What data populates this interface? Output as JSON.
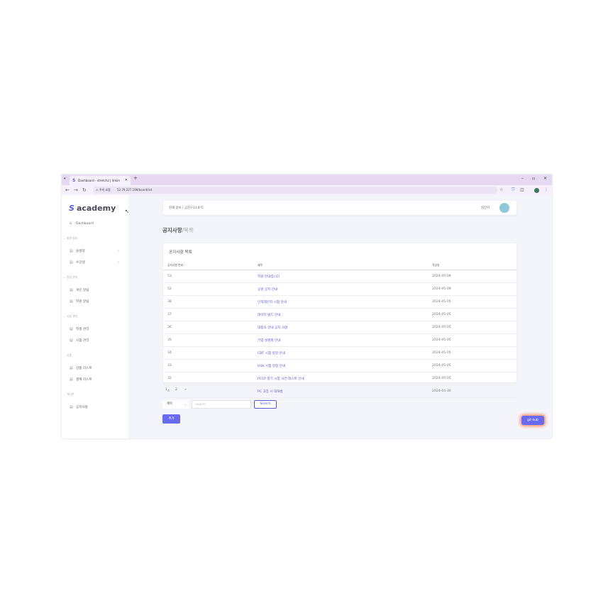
{
  "browser": {
    "tab_title": "Dashboard - stretchz | linkin",
    "url_warning": "주의 요함",
    "url": "52.79.227.198/board/list"
  },
  "sidebar": {
    "logo": "academy",
    "dashboard": "Dashboard",
    "sections": [
      {
        "label": "회원 정보",
        "items": [
          "원생정",
          "수강생"
        ]
      },
      {
        "label": "알림 관리",
        "items": [
          "개인 알림",
          "학원 알림"
        ]
      },
      {
        "label": "시험 관리",
        "items": [
          "학생 관리",
          "시험 관리"
        ]
      },
      {
        "label": "상품",
        "items": [
          "상품 리스트",
          "결제 리스트"
        ]
      },
      {
        "label": "게시판",
        "items": [
          "공지사항"
        ]
      }
    ]
  },
  "topbar": {
    "location": "현재 날씨 / 금천구13.8°C",
    "user": "김민지"
  },
  "page": {
    "title": "공지사항",
    "subtitle": "/목록"
  },
  "notice_list": {
    "card_title": "공지사항 목록",
    "columns": [
      "공지사항 번호",
      "제목",
      "작성일"
    ],
    "rows": [
      {
        "no": "53",
        "title": "학원 안내입니다",
        "date": "2024-05-09"
      },
      {
        "no": "52",
        "title": "공원 공지 안내",
        "date": "2024-05-09"
      },
      {
        "no": "38",
        "title": "인적레인지 시험 안내",
        "date": "2024-05-05"
      },
      {
        "no": "37",
        "title": "데이터 빌드 안내",
        "date": "2024-05-05"
      },
      {
        "no": "36",
        "title": "대청소 안내 공지 사항",
        "date": "2024-05-05"
      },
      {
        "no": "35",
        "title": "기업 설명회 안내",
        "date": "2024-05-05"
      },
      {
        "no": "34",
        "title": "CBT 시험 일정 안내",
        "date": "2024-05-05"
      },
      {
        "no": "33",
        "title": "HSK 시험 일정 안내",
        "date": "2024-05-05"
      },
      {
        "no": "32",
        "title": "PCCP 정기 시험 사전 테스트 안내",
        "date": "2024-05-05"
      },
      {
        "no": "4",
        "title": "PC 고장 시 대처법",
        "date": "2024-04-30"
      }
    ]
  },
  "pagination": [
    "1",
    "2",
    "»"
  ],
  "search": {
    "select_value": "제목",
    "placeholder": "Search",
    "button": "Search"
  },
  "add_button": "추가",
  "github_button": "git-hub"
}
